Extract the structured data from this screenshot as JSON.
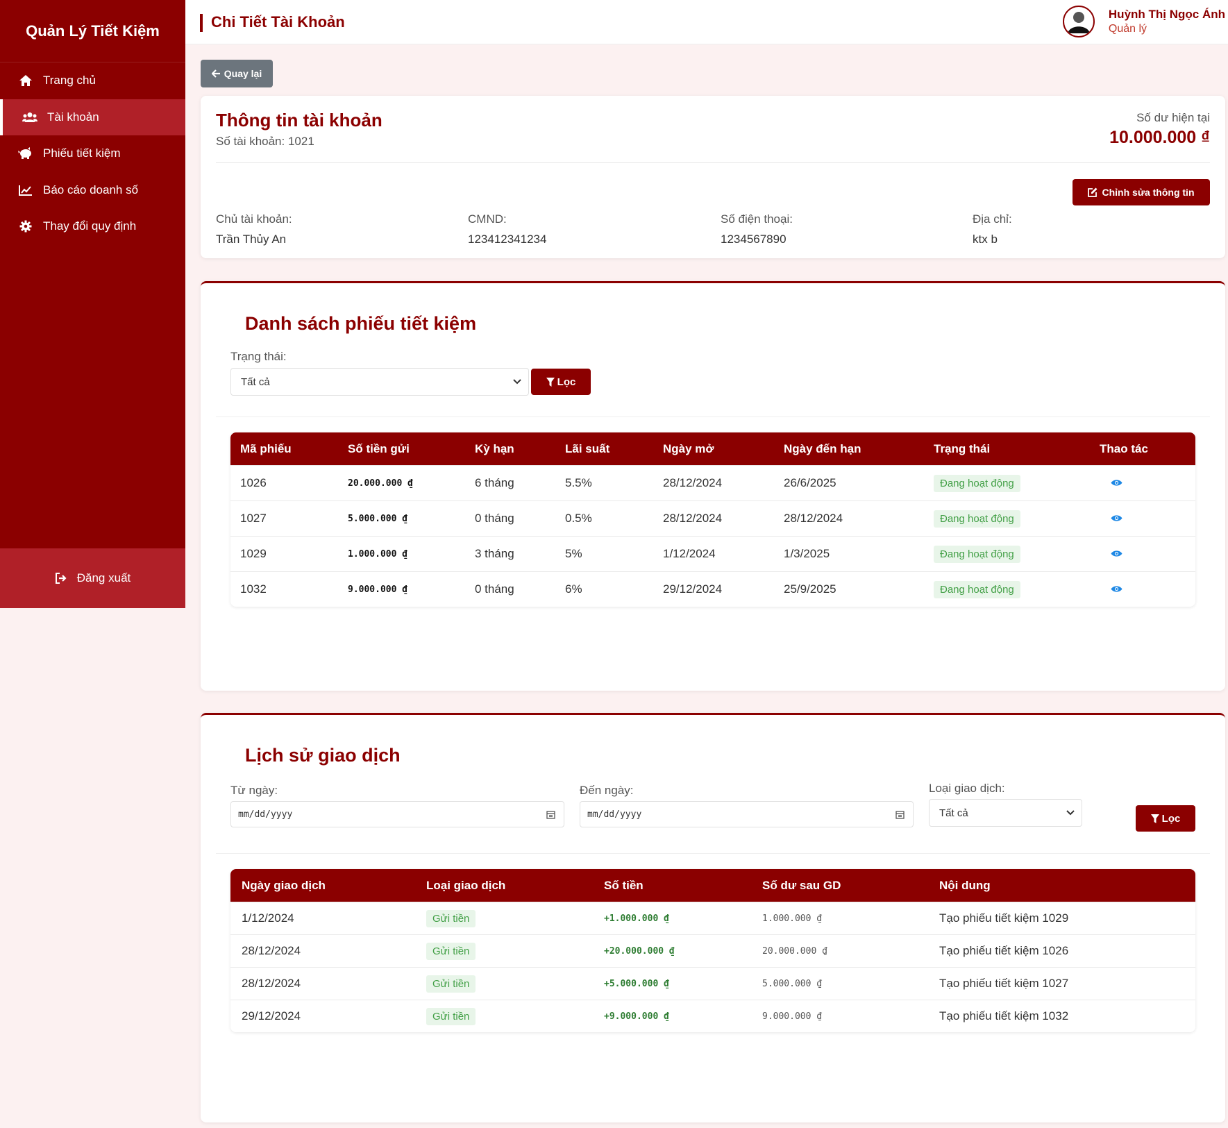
{
  "sidebar": {
    "brand": "Quản Lý Tiết Kiệm",
    "items": [
      {
        "label": "Trang chủ",
        "icon": "home-icon"
      },
      {
        "label": "Tài khoản",
        "icon": "users-icon"
      },
      {
        "label": "Phiếu tiết kiệm",
        "icon": "piggy-bank-icon"
      },
      {
        "label": "Báo cáo doanh số",
        "icon": "chart-icon"
      },
      {
        "label": "Thay đổi quy định",
        "icon": "gear-icon"
      }
    ],
    "active_index": 1,
    "logout_label": "Đăng xuất"
  },
  "header": {
    "title": "Chi Tiết Tài Khoản",
    "user_name": "Huỳnh Thị Ngọc Ánh",
    "user_role": "Quản lý"
  },
  "back_label": "Quay lại",
  "account": {
    "title": "Thông tin tài khoản",
    "number_text": "Số tài khoản: 1021",
    "balance_label": "Số dư hiện tại",
    "balance_value": "10.000.000 ₫",
    "edit_label": "Chỉnh sửa thông tin",
    "fields": [
      {
        "label": "Chủ tài khoản:",
        "value": "Trần Thủy An"
      },
      {
        "label": "CMND:",
        "value": "123412341234"
      },
      {
        "label": "Số điện thoại:",
        "value": "1234567890"
      },
      {
        "label": "Địa chỉ:",
        "value": "ktx b"
      }
    ]
  },
  "savings": {
    "title": "Danh sách phiếu tiết kiệm",
    "status_label": "Trạng thái:",
    "status_value": "Tất cả",
    "filter_label": "Lọc",
    "columns": [
      "Mã phiếu",
      "Số tiền gửi",
      "Kỳ hạn",
      "Lãi suất",
      "Ngày mở",
      "Ngày đến hạn",
      "Trạng thái",
      "Thao tác"
    ],
    "rows": [
      {
        "id": "1026",
        "amount": "20.000.000 ₫",
        "term": "6 tháng",
        "rate": "5.5%",
        "open": "28/12/2024",
        "due": "26/6/2025",
        "status": "Đang hoạt động"
      },
      {
        "id": "1027",
        "amount": "5.000.000 ₫",
        "term": "0 tháng",
        "rate": "0.5%",
        "open": "28/12/2024",
        "due": "28/12/2024",
        "status": "Đang hoạt động"
      },
      {
        "id": "1029",
        "amount": "1.000.000 ₫",
        "term": "3 tháng",
        "rate": "5%",
        "open": "1/12/2024",
        "due": "1/3/2025",
        "status": "Đang hoạt động"
      },
      {
        "id": "1032",
        "amount": "9.000.000 ₫",
        "term": "0 tháng",
        "rate": "6%",
        "open": "29/12/2024",
        "due": "25/9/2025",
        "status": "Đang hoạt động"
      }
    ]
  },
  "history": {
    "title": "Lịch sử giao dịch",
    "from_label": "Từ ngày:",
    "to_label": "Đến ngày:",
    "date_placeholder": "mm/dd/yyyy",
    "type_label": "Loại giao dịch:",
    "type_value": "Tất cả",
    "filter_label": "Lọc",
    "columns": [
      "Ngày giao dịch",
      "Loại giao dịch",
      "Số tiền",
      "Số dư sau GD",
      "Nội dung"
    ],
    "rows": [
      {
        "date": "1/12/2024",
        "type": "Gửi tiền",
        "amount": "+1.000.000 ₫",
        "balance": "1.000.000 ₫",
        "note": "Tạo phiếu tiết kiệm 1029"
      },
      {
        "date": "28/12/2024",
        "type": "Gửi tiền",
        "amount": "+20.000.000 ₫",
        "balance": "20.000.000 ₫",
        "note": "Tạo phiếu tiết kiệm 1026"
      },
      {
        "date": "28/12/2024",
        "type": "Gửi tiền",
        "amount": "+5.000.000 ₫",
        "balance": "5.000.000 ₫",
        "note": "Tạo phiếu tiết kiệm 1027"
      },
      {
        "date": "29/12/2024",
        "type": "Gửi tiền",
        "amount": "+9.000.000 ₫",
        "balance": "9.000.000 ₫",
        "note": "Tạo phiếu tiết kiệm 1032"
      }
    ]
  },
  "colors": {
    "brand": "#8b0000",
    "sidebar_active": "#b02028",
    "status_bg": "#e8f5e9",
    "status_text": "#43a047",
    "eye": "#1e88e5"
  }
}
